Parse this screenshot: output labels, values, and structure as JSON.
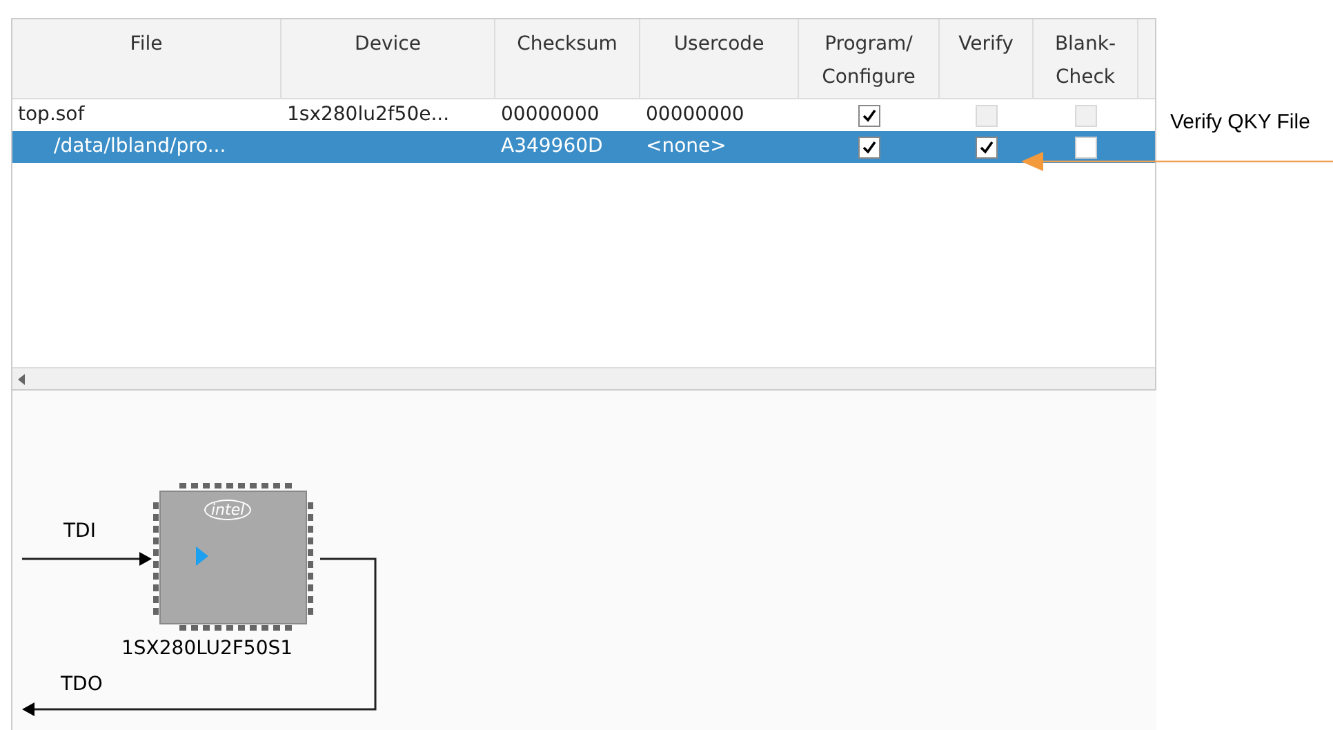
{
  "table": {
    "columns": [
      "File",
      "Device",
      "Checksum",
      "Usercode",
      "Program/ Configure",
      "Verify",
      "Blank- Check"
    ],
    "rows": [
      {
        "file": "top.sof",
        "indent": false,
        "device": "1sx280lu2f50e...",
        "checksum": "00000000",
        "usercode": "00000000",
        "program": {
          "checked": true
        },
        "verify": {
          "checked": false
        },
        "blank_check": {
          "checked": false
        },
        "selected": false
      },
      {
        "file": "/data/lbland/pro...",
        "indent": true,
        "checksum": "A349960D",
        "usercode": "<none>",
        "program": {
          "checked": true
        },
        "verify": {
          "checked": true
        },
        "blank_check": {
          "checked": false
        },
        "selected": true
      }
    ]
  },
  "callout": {
    "label": "Verify QKY File"
  },
  "chain": {
    "tdi": "TDI",
    "tdo": "TDO",
    "chip": {
      "logo": "intel",
      "name": "1SX280LU2F50S1"
    }
  }
}
